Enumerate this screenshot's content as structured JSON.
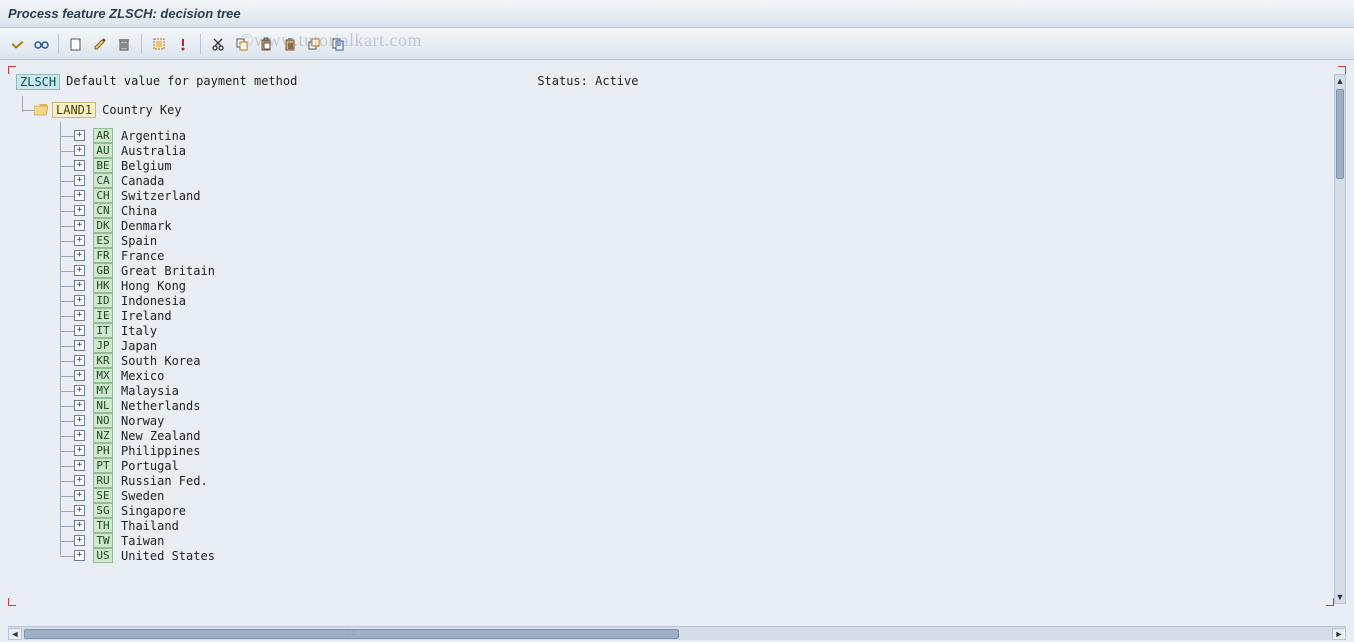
{
  "title": "Process feature ZLSCH: decision tree",
  "watermark": "©www.tutorialkart.com",
  "toolbar_icons": [
    "check-icon",
    "glasses-icon",
    "sep",
    "new-icon",
    "edit-icon",
    "delete-icon",
    "sep",
    "select-icon",
    "info-icon",
    "sep",
    "cut-icon",
    "copy-icon",
    "paste-icon",
    "paste-special-icon",
    "undo-icon",
    "find-icon"
  ],
  "root": {
    "code": "ZLSCH",
    "desc": "Default value for payment method",
    "status_label": "Status:",
    "status_value": "Active"
  },
  "branch": {
    "code": "LAND1",
    "desc": "Country Key"
  },
  "countries": [
    {
      "cc": "AR",
      "name": "Argentina"
    },
    {
      "cc": "AU",
      "name": "Australia"
    },
    {
      "cc": "BE",
      "name": "Belgium"
    },
    {
      "cc": "CA",
      "name": "Canada"
    },
    {
      "cc": "CH",
      "name": "Switzerland"
    },
    {
      "cc": "CN",
      "name": "China"
    },
    {
      "cc": "DK",
      "name": "Denmark"
    },
    {
      "cc": "ES",
      "name": "Spain"
    },
    {
      "cc": "FR",
      "name": "France"
    },
    {
      "cc": "GB",
      "name": "Great Britain"
    },
    {
      "cc": "HK",
      "name": "Hong Kong"
    },
    {
      "cc": "ID",
      "name": "Indonesia"
    },
    {
      "cc": "IE",
      "name": "Ireland"
    },
    {
      "cc": "IT",
      "name": "Italy"
    },
    {
      "cc": "JP",
      "name": "Japan"
    },
    {
      "cc": "KR",
      "name": "South Korea"
    },
    {
      "cc": "MX",
      "name": "Mexico"
    },
    {
      "cc": "MY",
      "name": "Malaysia"
    },
    {
      "cc": "NL",
      "name": "Netherlands"
    },
    {
      "cc": "NO",
      "name": "Norway"
    },
    {
      "cc": "NZ",
      "name": "New Zealand"
    },
    {
      "cc": "PH",
      "name": "Philippines"
    },
    {
      "cc": "PT",
      "name": "Portugal"
    },
    {
      "cc": "RU",
      "name": "Russian Fed."
    },
    {
      "cc": "SE",
      "name": "Sweden"
    },
    {
      "cc": "SG",
      "name": "Singapore"
    },
    {
      "cc": "TH",
      "name": "Thailand"
    },
    {
      "cc": "TW",
      "name": "Taiwan"
    },
    {
      "cc": "US",
      "name": "United States"
    }
  ]
}
